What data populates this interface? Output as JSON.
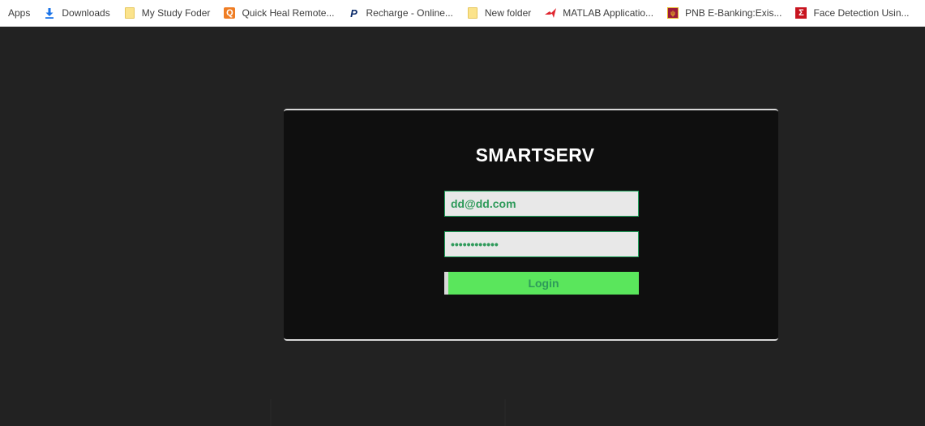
{
  "bookmarks": {
    "apps_label": "Apps",
    "items": [
      {
        "label": "Downloads",
        "icon": "download-icon"
      },
      {
        "label": "My Study Foder",
        "icon": "folder-icon"
      },
      {
        "label": "Quick Heal Remote...",
        "icon": "quick-heal-icon"
      },
      {
        "label": "Recharge - Online...",
        "icon": "paypal-icon"
      },
      {
        "label": "New folder",
        "icon": "folder-icon"
      },
      {
        "label": "MATLAB Applicatio...",
        "icon": "matlab-icon"
      },
      {
        "label": "PNB E-Banking:Exis...",
        "icon": "pnb-icon"
      },
      {
        "label": "Face Detection Usin...",
        "icon": "sigma-icon"
      }
    ]
  },
  "login": {
    "title": "SMARTSERV",
    "email_value": "dd@dd.com",
    "password_value": "••••••••••••",
    "button_label": "Login"
  },
  "colors": {
    "page_background": "#222222",
    "card_background": "#0f0f0f",
    "field_background": "#e8e8e8",
    "field_text": "#2e9a5a",
    "button_background": "#5ae65c"
  }
}
